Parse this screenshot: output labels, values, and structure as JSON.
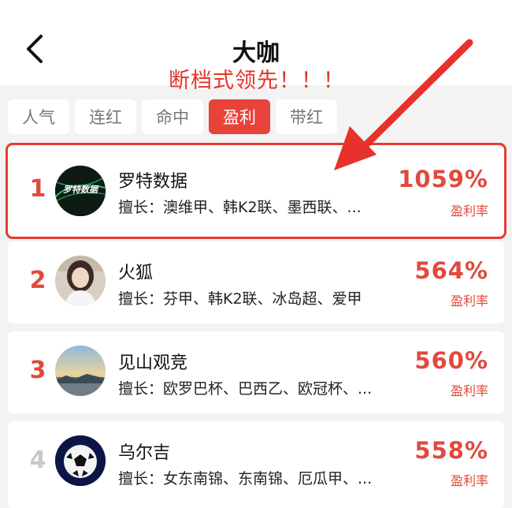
{
  "header": {
    "title": "大咖",
    "back_icon": "chevron-left-icon"
  },
  "annotation": "断档式领先！！！",
  "tabs": [
    {
      "label": "人气",
      "active": false
    },
    {
      "label": "连红",
      "active": false
    },
    {
      "label": "命中",
      "active": false
    },
    {
      "label": "盈利",
      "active": true
    },
    {
      "label": "带红",
      "active": false
    }
  ],
  "experts": [
    {
      "rank": "1",
      "name": "罗特数据",
      "specialty": "擅长：澳维甲、韩K2联、墨西联、...",
      "rate": "1059%",
      "rate_label": "盈利率",
      "avatar": "logo-avatar",
      "avatar_text": "罗特数据"
    },
    {
      "rank": "2",
      "name": "火狐",
      "specialty": "擅长：芬甲、韩K2联、冰岛超、爱甲",
      "rate": "564%",
      "rate_label": "盈利率",
      "avatar": "person-avatar"
    },
    {
      "rank": "3",
      "name": "见山观竞",
      "specialty": "擅长：欧罗巴杯、巴西乙、欧冠杯、...",
      "rate": "560%",
      "rate_label": "盈利率",
      "avatar": "landscape-avatar"
    },
    {
      "rank": "4",
      "name": "乌尔吉",
      "specialty": "擅长：女东南锦、东南锦、厄瓜甲、...",
      "rate": "558%",
      "rate_label": "盈利率",
      "avatar": "soccer-ball-avatar"
    }
  ],
  "colors": {
    "accent": "#e8433a",
    "rank": "#e04a3d",
    "highlight": "#e83a30",
    "muted_rank": "#c9c9c9"
  }
}
